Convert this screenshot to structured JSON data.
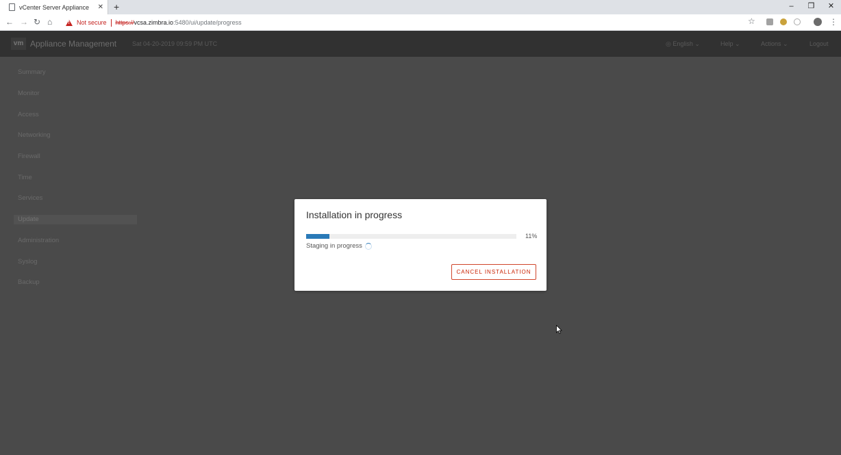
{
  "browser": {
    "tab_title": "vCenter Server Appliance",
    "tab_close": "✕",
    "new_tab": "+",
    "window_controls": [
      "–",
      "❐",
      "✕"
    ],
    "security_label": "Not secure",
    "url_scheme": "https://",
    "url_host": "vcsa.zimbra.io",
    "url_path": ":5480/ui/update/progress"
  },
  "header": {
    "logo": "vm",
    "title": "Appliance Management",
    "datetime": "Sat 04-20-2019 09:59 PM UTC",
    "menus": [
      "◎ English ⌄",
      "Help ⌄",
      "Actions ⌄",
      "Logout"
    ]
  },
  "sidebar": {
    "items": [
      "Summary",
      "Monitor",
      "Access",
      "Networking",
      "Firewall",
      "Time",
      "Services",
      "Update",
      "Administration",
      "Syslog",
      "Backup"
    ],
    "active": "Update"
  },
  "dialog": {
    "title": "Installation in progress",
    "progress_percent": 11,
    "progress_label": "11%",
    "status": "Staging in progress",
    "cancel_label": "CANCEL INSTALLATION"
  },
  "colors": {
    "progress": "#2a7ab8",
    "danger": "#c92100",
    "header_bg": "#313131",
    "overlay_bg": "#4a4a4a"
  }
}
